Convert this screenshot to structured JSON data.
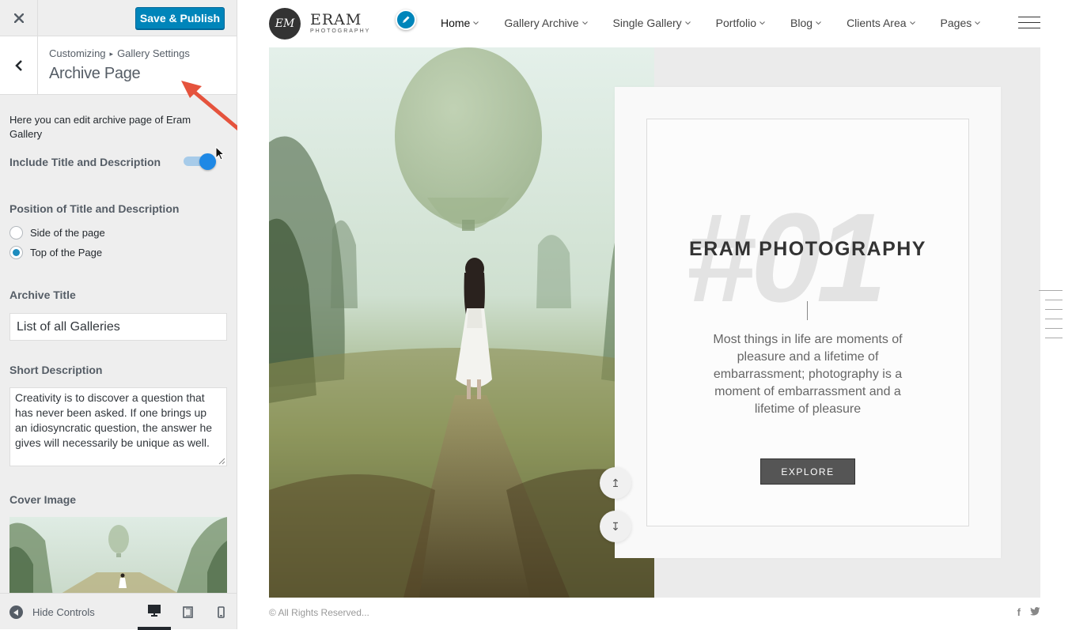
{
  "sidebar": {
    "save_label": "Save & Publish",
    "breadcrumb": {
      "root": "Customizing",
      "panel": "Gallery Settings"
    },
    "section_title": "Archive Page",
    "description": "Here you can edit archive page of Eram Gallery",
    "include_toggle": {
      "label": "Include Title and Description",
      "enabled": true
    },
    "position": {
      "label": "Position of Title and Description",
      "options": [
        {
          "label": "Side of the page",
          "checked": false
        },
        {
          "label": "Top of the Page",
          "checked": true
        }
      ]
    },
    "archive_title": {
      "label": "Archive Title",
      "value": "List of all Galleries"
    },
    "short_description": {
      "label": "Short Description",
      "value": "Creativity is to discover a question that has never been asked. If one brings up an idiosyncratic question, the answer he gives will necessarily be unique as well."
    },
    "cover_image": {
      "label": "Cover Image"
    },
    "footer": {
      "hide_controls": "Hide Controls",
      "active_device": "desktop"
    }
  },
  "site": {
    "logo": {
      "mark": "EM",
      "brand": "ERAM",
      "sub": "PHOTOGRAPHY"
    },
    "nav": [
      {
        "label": "Home",
        "active": true
      },
      {
        "label": "Gallery Archive",
        "active": false
      },
      {
        "label": "Single Gallery",
        "active": false
      },
      {
        "label": "Portfolio",
        "active": false
      },
      {
        "label": "Blog",
        "active": false
      },
      {
        "label": "Clients Area",
        "active": false
      },
      {
        "label": "Pages",
        "active": false
      }
    ],
    "hero": {
      "number": "#01",
      "title": "ERAM PHOTOGRAPHY",
      "text": "Most things in life are moments of pleasure and a lifetime of embarrassment; photography is a moment of embarrassment and a lifetime of pleasure",
      "button": "EXPLORE",
      "scroll_up": "↥",
      "scroll_down": "↧"
    },
    "footer": {
      "copyright": "© All Rights Reserved...",
      "social": [
        "f",
        "t"
      ]
    }
  },
  "colors": {
    "accent": "#0085ba",
    "toggle_on": "#1e88e5",
    "arrow": "#e5533d"
  }
}
